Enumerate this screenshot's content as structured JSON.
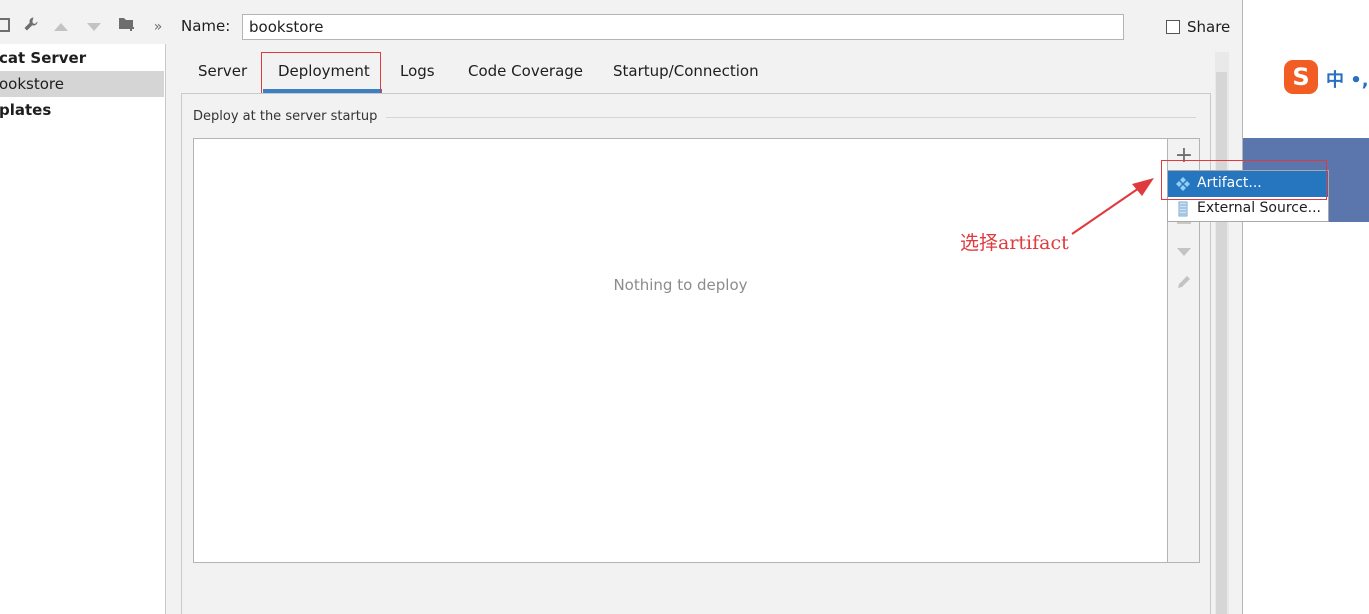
{
  "toolbar": {
    "icons": [
      "save-icon",
      "wrench-icon",
      "arrow-up-icon",
      "arrow-down-icon",
      "folder-add-icon",
      "more-icon"
    ],
    "more_glyph": "»"
  },
  "tree": {
    "items": [
      {
        "label": "cat Server",
        "bold": true,
        "selected": false
      },
      {
        "label": "ookstore",
        "bold": false,
        "selected": true
      },
      {
        "label": "plates",
        "bold": true,
        "selected": false
      }
    ]
  },
  "name": {
    "label": "Name:",
    "value": "bookstore"
  },
  "share": {
    "label": "Share",
    "checked": false
  },
  "tabs": [
    {
      "label": "Server",
      "active": false
    },
    {
      "label": "Deployment",
      "active": true
    },
    {
      "label": "Logs",
      "active": false
    },
    {
      "label": "Code Coverage",
      "active": false
    },
    {
      "label": "Startup/Connection",
      "active": false
    }
  ],
  "deploy": {
    "group_title": "Deploy at the server startup",
    "empty_text": "Nothing to deploy"
  },
  "side_toolbar": {
    "icons": [
      "plus-icon",
      "minus-icon",
      "move-down-icon",
      "edit-icon"
    ],
    "plus_glyph": "+"
  },
  "popup": {
    "items": [
      {
        "label": "Artifact...",
        "icon": "artifact-icon",
        "highlighted": true
      },
      {
        "label": "External Source...",
        "icon": "external-source-icon",
        "highlighted": false
      }
    ]
  },
  "annotation": {
    "text": "选择artifact"
  },
  "ime": {
    "logo": "S",
    "text": "中 •,"
  },
  "colors": {
    "accent": "#3e7fc1",
    "selection": "#2675bf",
    "annotation_red": "#e0393e",
    "ime_orange": "#f15d22"
  }
}
